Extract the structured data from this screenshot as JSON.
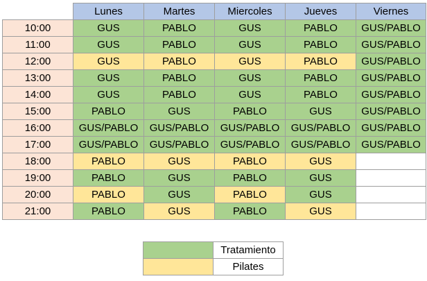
{
  "days": [
    "Lunes",
    "Martes",
    "Miercoles",
    "Jueves",
    "Viernes"
  ],
  "rows": [
    {
      "time": "10:00",
      "cells": [
        [
          "GUS",
          "t"
        ],
        [
          "PABLO",
          "t"
        ],
        [
          "GUS",
          "t"
        ],
        [
          "PABLO",
          "t"
        ],
        [
          "GUS/PABLO",
          "t"
        ]
      ]
    },
    {
      "time": "11:00",
      "cells": [
        [
          "GUS",
          "t"
        ],
        [
          "PABLO",
          "t"
        ],
        [
          "GUS",
          "t"
        ],
        [
          "PABLO",
          "t"
        ],
        [
          "GUS/PABLO",
          "t"
        ]
      ]
    },
    {
      "time": "12:00",
      "cells": [
        [
          "GUS",
          "p"
        ],
        [
          "PABLO",
          "p"
        ],
        [
          "GUS",
          "p"
        ],
        [
          "PABLO",
          "p"
        ],
        [
          "GUS/PABLO",
          "t"
        ]
      ]
    },
    {
      "time": "13:00",
      "cells": [
        [
          "GUS",
          "t"
        ],
        [
          "PABLO",
          "t"
        ],
        [
          "GUS",
          "t"
        ],
        [
          "PABLO",
          "t"
        ],
        [
          "GUS/PABLO",
          "t"
        ]
      ]
    },
    {
      "time": "14:00",
      "cells": [
        [
          "GUS",
          "t"
        ],
        [
          "PABLO",
          "t"
        ],
        [
          "GUS",
          "t"
        ],
        [
          "PABLO",
          "t"
        ],
        [
          "GUS/PABLO",
          "t"
        ]
      ]
    },
    {
      "time": "15:00",
      "cells": [
        [
          "PABLO",
          "t"
        ],
        [
          "GUS",
          "t"
        ],
        [
          "PABLO",
          "t"
        ],
        [
          "GUS",
          "t"
        ],
        [
          "GUS/PABLO",
          "t"
        ]
      ]
    },
    {
      "time": "16:00",
      "cells": [
        [
          "GUS/PABLO",
          "t"
        ],
        [
          "GUS/PABLO",
          "t"
        ],
        [
          "GUS/PABLO",
          "t"
        ],
        [
          "GUS/PABLO",
          "t"
        ],
        [
          "GUS/PABLO",
          "t"
        ]
      ]
    },
    {
      "time": "17:00",
      "cells": [
        [
          "GUS/PABLO",
          "t"
        ],
        [
          "GUS/PABLO",
          "t"
        ],
        [
          "GUS/PABLO",
          "t"
        ],
        [
          "GUS/PABLO",
          "t"
        ],
        [
          "GUS/PABLO",
          "t"
        ]
      ]
    },
    {
      "time": "18:00",
      "cells": [
        [
          "PABLO",
          "p"
        ],
        [
          "GUS",
          "p"
        ],
        [
          "PABLO",
          "p"
        ],
        [
          "GUS",
          "p"
        ],
        [
          "",
          "empty"
        ]
      ]
    },
    {
      "time": "19:00",
      "cells": [
        [
          "PABLO",
          "t"
        ],
        [
          "GUS",
          "t"
        ],
        [
          "PABLO",
          "t"
        ],
        [
          "GUS",
          "t"
        ],
        [
          "",
          "empty"
        ]
      ]
    },
    {
      "time": "20:00",
      "cells": [
        [
          "PABLO",
          "p"
        ],
        [
          "GUS",
          "t"
        ],
        [
          "PABLO",
          "p"
        ],
        [
          "GUS",
          "t"
        ],
        [
          "",
          "empty"
        ]
      ]
    },
    {
      "time": "21:00",
      "cells": [
        [
          "PABLO",
          "t"
        ],
        [
          "GUS",
          "p"
        ],
        [
          "PABLO",
          "t"
        ],
        [
          "GUS",
          "p"
        ],
        [
          "",
          "empty"
        ]
      ]
    }
  ],
  "colors": {
    "tratamiento": "#a9d18e",
    "pilates": "#ffe699",
    "header": "#b4c7e7",
    "time": "#fce4d6"
  },
  "legend": [
    {
      "label": "Tratamiento",
      "type": "t"
    },
    {
      "label": "Pilates",
      "type": "p"
    }
  ]
}
